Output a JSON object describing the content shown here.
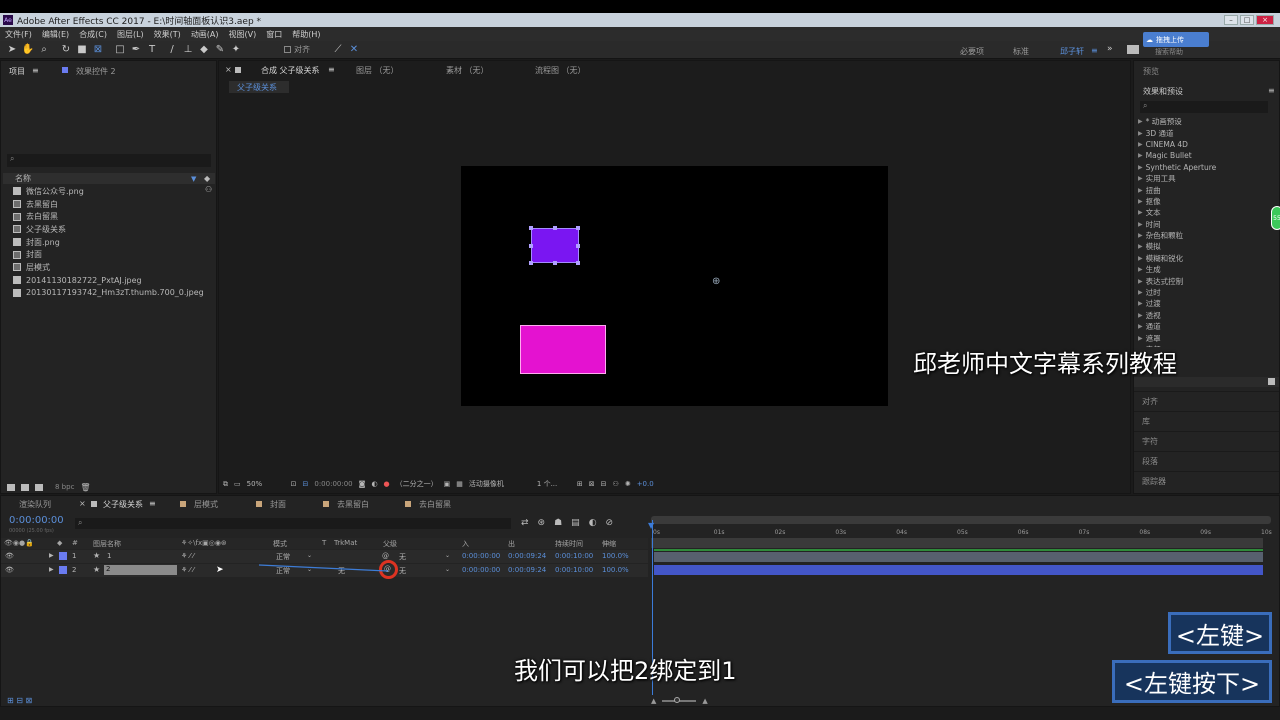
{
  "window": {
    "title": "Adobe After Effects CC 2017 - E:\\时间轴面板认识3.aep *"
  },
  "menu": [
    "文件(F)",
    "编辑(E)",
    "合成(C)",
    "图层(L)",
    "效果(T)",
    "动画(A)",
    "视图(V)",
    "窗口",
    "帮助(H)"
  ],
  "toolbar": {
    "snap_label": "对齐",
    "workspaces": [
      "必要项",
      "标准",
      "邱子轩"
    ],
    "search_placeholder": "搜索帮助",
    "upload_badge": "拖拽上传"
  },
  "project_panel": {
    "tab_project": "项目",
    "tab_effects": "效果控件 2",
    "column_name": "名称",
    "bpc": "8 bpc",
    "items": [
      {
        "name": "微信公众号.png",
        "type": "file"
      },
      {
        "name": "去黑留白",
        "type": "comp"
      },
      {
        "name": "去白留黑",
        "type": "comp"
      },
      {
        "name": "父子级关系",
        "type": "comp"
      },
      {
        "name": "封面.png",
        "type": "file"
      },
      {
        "name": "封面",
        "type": "comp"
      },
      {
        "name": "层模式",
        "type": "comp"
      },
      {
        "name": "20141130182722_PxtAJ.jpeg",
        "type": "file"
      },
      {
        "name": "20130117193742_Hm3zT.thumb.700_0.jpeg",
        "type": "file"
      }
    ]
  },
  "viewer": {
    "tabs": [
      "合成 父子级关系",
      "图层 （无）",
      "素材 （无）",
      "流程图 （无）"
    ],
    "breadcrumb": "父子级关系",
    "zoom": "50%",
    "timecode": "0:00:00:00",
    "resolution": "（二分之一）",
    "camera": "活动摄像机",
    "views": "1 个...",
    "exposure": "+0.0"
  },
  "right_panel": {
    "preview": "预览",
    "effects_title": "效果和预设",
    "effects": [
      "* 动画预设",
      "3D 通道",
      "CINEMA 4D",
      "Magic Bullet",
      "Synthetic Aperture",
      "实用工具",
      "扭曲",
      "抠像",
      "文本",
      "时间",
      "杂色和颗粒",
      "模拟",
      "模糊和锐化",
      "生成",
      "表达式控制",
      "过时",
      "过渡",
      "透视",
      "通道",
      "遮罩",
      "音频"
    ],
    "bottom_items": [
      "对齐",
      "库",
      "字符",
      "段落",
      "跟踪器"
    ]
  },
  "timeline": {
    "tabs": [
      "渲染队列",
      "父子级关系",
      "层模式",
      "封面",
      "去黑留白",
      "去白留黑"
    ],
    "timecode": "0:00:00:00",
    "timecode_sub": "00000 (25.00 fps)",
    "columns": {
      "num": "#",
      "name": "图层名称",
      "mode": "模式",
      "t": "T",
      "trkmat": "TrkMat",
      "parent": "父级",
      "in": "入",
      "out": "出",
      "duration": "持续时间",
      "stretch": "伸缩"
    },
    "layers": [
      {
        "num": "1",
        "name": "1",
        "mode": "正常",
        "trkmat": "",
        "parent": "无",
        "in": "0:00:00:00",
        "out": "0:00:09:24",
        "duration": "0:00:10:00",
        "stretch": "100.0%",
        "color": "#6a7bf0"
      },
      {
        "num": "2",
        "name": "2",
        "mode": "正常",
        "trkmat": "无",
        "parent": "无",
        "in": "0:00:00:00",
        "out": "0:00:09:24",
        "duration": "0:00:10:00",
        "stretch": "100.0%",
        "color": "#6a7bf0"
      }
    ],
    "ruler": [
      "0s",
      "01s",
      "02s",
      "03s",
      "04s",
      "05s",
      "06s",
      "07s",
      "08s",
      "09s",
      "10s"
    ]
  },
  "overlays": {
    "watermark": "邱老师中文字幕系列教程",
    "subtitle": "我们可以把2绑定到1",
    "key1": "<左键>",
    "key2": "<左键按下>"
  },
  "colors": {
    "shape1": "#7a16f2",
    "shape2": "#e412d0",
    "accent": "#3a6dbb"
  }
}
